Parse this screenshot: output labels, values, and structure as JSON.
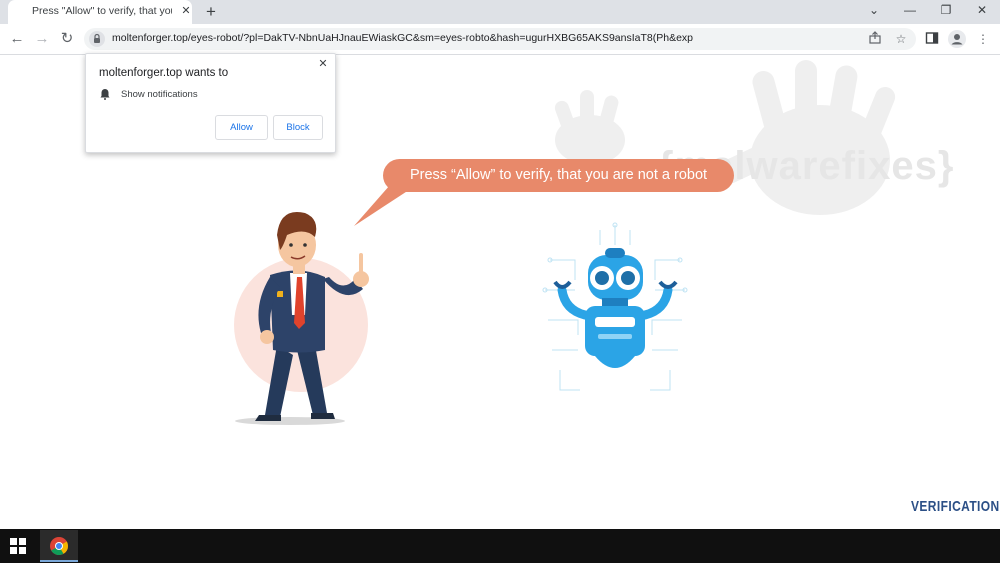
{
  "browser": {
    "tab_title": "Press \"Allow\" to verify, that you a",
    "new_tab_label": "+",
    "window_controls": {
      "tabs_dropdown": "⌄",
      "minimize": "—",
      "restore": "❐",
      "close": "✕"
    }
  },
  "toolbar": {
    "url": "moltenforger.top/eyes-robot/?pl=DakTV-NbnUaHJnauEWiaskGC&sm=eyes-robto&hash=ugurHXBG65AKS9ansIaT8(Ph&exp"
  },
  "notification_popup": {
    "title": "moltenforger.top wants to",
    "permission": "Show notifications",
    "allow_label": "Allow",
    "block_label": "Block"
  },
  "page": {
    "speech_bubble": "Press “Allow” to verify, that you are not a robot",
    "watermark": "{malwarefixes}",
    "verification_label": "VERIFICATION"
  },
  "colors": {
    "bubble": "#e8896a",
    "robot_blue": "#2ba4e6",
    "verification": "#2b4f86"
  },
  "icons": [
    "back-arrow-icon",
    "forward-arrow-icon",
    "reload-icon",
    "lock-icon",
    "share-icon",
    "star-icon",
    "sidebar-icon",
    "profile-icon",
    "menu-icon",
    "bell-icon",
    "windows-start-icon",
    "chrome-icon"
  ]
}
